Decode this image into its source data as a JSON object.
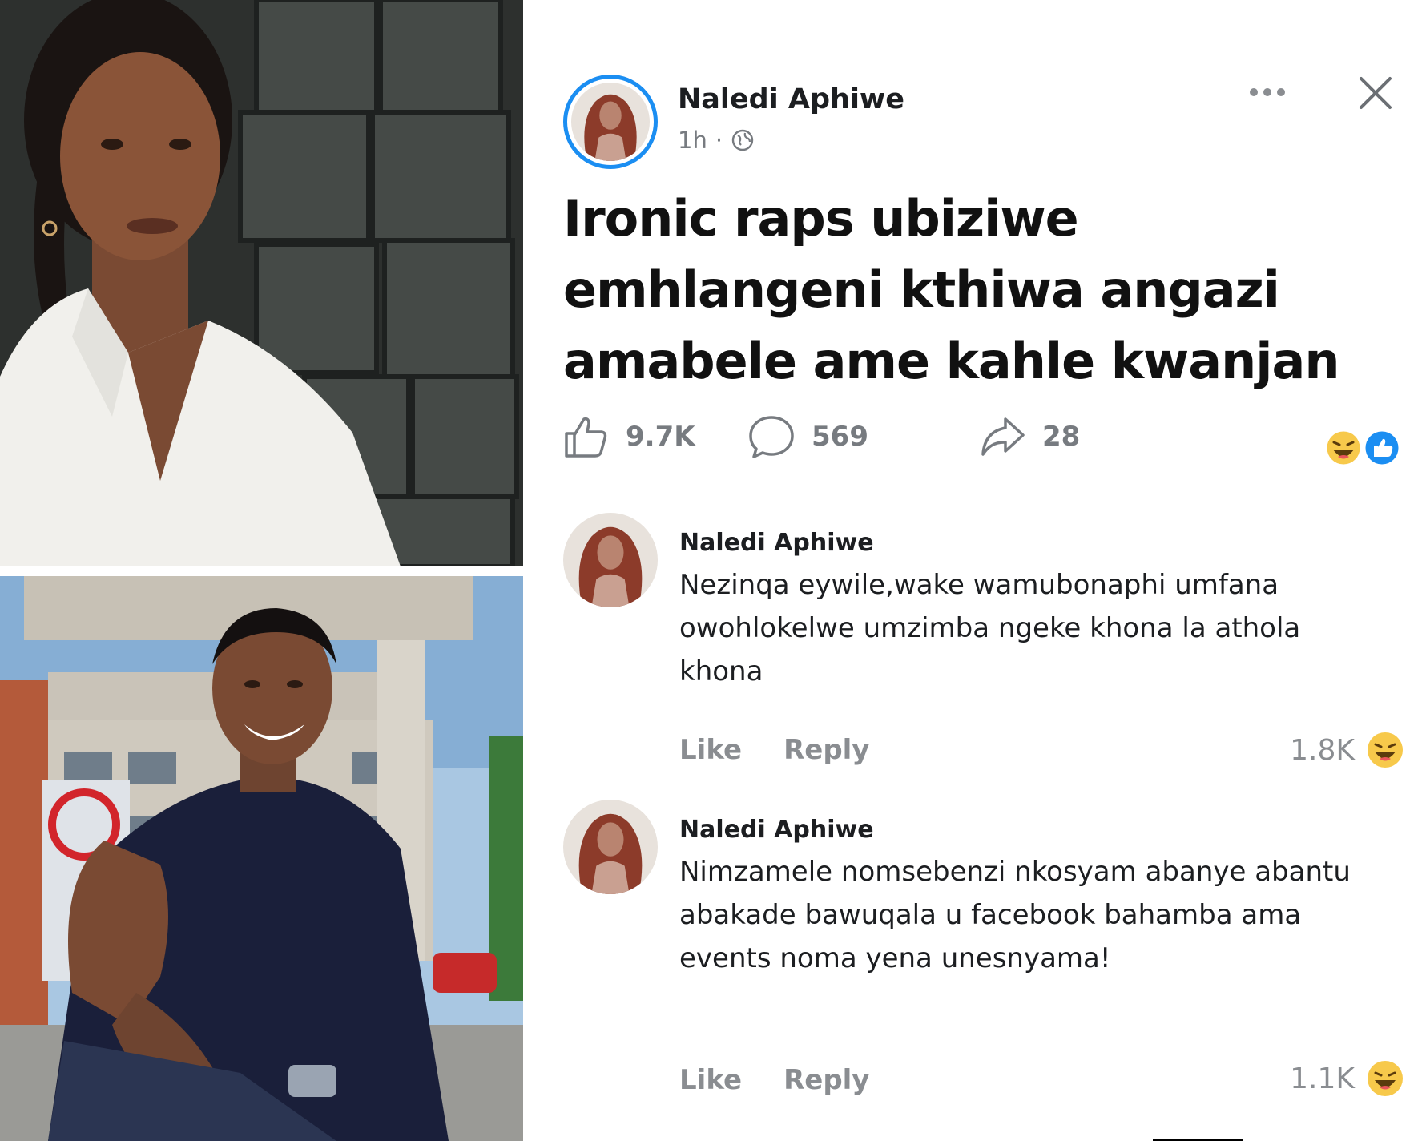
{
  "post": {
    "author": "Naledi Aphiwe",
    "time": "1h",
    "separator": "·",
    "text": "Ironic raps ubiziwe emhlangeni kthiwa angazi amabele ame kahle kwanjan",
    "likes": "9.7K",
    "comments": "569",
    "shares": "28",
    "icons": {
      "privacy": "globe-icon",
      "more": "more-options-icon",
      "close": "close-icon",
      "like": "thumbs-up-icon",
      "comment": "comment-bubble-icon",
      "share": "share-arrow-icon",
      "reactions": [
        "haha-reaction-icon",
        "like-reaction-icon"
      ]
    }
  },
  "comments": [
    {
      "author": "Naledi Aphiwe",
      "text": "Nezinqa eywile,wake wamubonaphi umfana owohlokelwe umzimba ngeke khona la athola khona",
      "like_label": "Like",
      "reply_label": "Reply",
      "reaction_count": "1.8K",
      "reaction_icon": "haha-reaction-icon"
    },
    {
      "author": "Naledi Aphiwe",
      "text": "Nimzamele nomsebenzi nkosyam abanye abantu abakade bawuqala u facebook bahamba ama events noma yena unesnyama!",
      "like_label": "Like",
      "reply_label": "Reply",
      "reaction_count": "1.1K",
      "reaction_icon": "haha-reaction-icon"
    }
  ],
  "colors": {
    "accent_blue": "#1b8ef2",
    "muted_text": "#777b80",
    "haha_yellow": "#f7c94b",
    "like_blue": "#1b8ef2"
  }
}
